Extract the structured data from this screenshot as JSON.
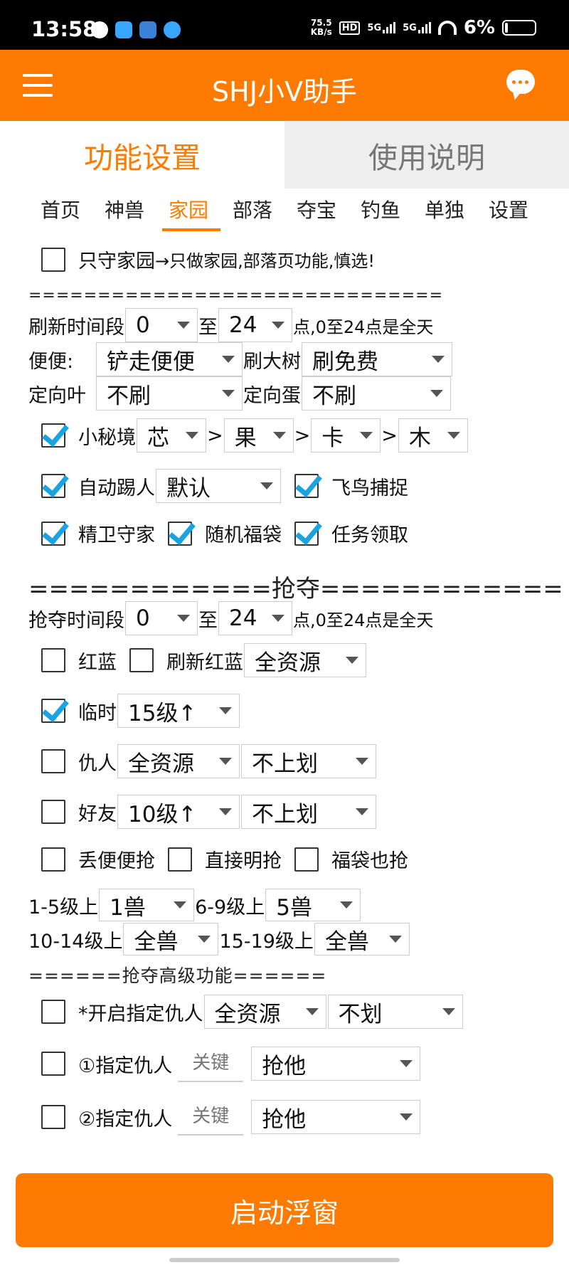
{
  "status_bar": {
    "time": "13:58",
    "net_speed_value": "75.5",
    "net_speed_unit": "KB/s",
    "signal1": "5G",
    "signal2": "5G",
    "hd_badge": "HD",
    "battery": "6%"
  },
  "app_bar": {
    "title": "SHJ小V助手"
  },
  "main_tabs": [
    {
      "label": "功能设置",
      "active": true
    },
    {
      "label": "使用说明",
      "active": false
    }
  ],
  "sub_tabs": [
    "首页",
    "神兽",
    "家园",
    "部落",
    "夺宝",
    "钓鱼",
    "单独",
    "设置"
  ],
  "active_sub_tab": "家园",
  "home_only": {
    "label": "只守家园",
    "note": "→只做家园,部落页功能,慎选!",
    "checked": false
  },
  "sep1": "==============================",
  "refresh": {
    "label": "刷新时间段",
    "from": "0",
    "to_label": "至",
    "to": "24",
    "suffix": "点,0至24点是全天"
  },
  "poop": {
    "label": "便便:",
    "value": "铲走便便",
    "tree_label": "刷大树",
    "tree_value": "刷免费"
  },
  "leaf": {
    "label": "定向叶",
    "value": "不刷",
    "egg_label": "定向蛋",
    "egg_value": "不刷"
  },
  "secret": {
    "label": "小秘境",
    "checked": true,
    "values": [
      "芯",
      "果",
      "卡",
      "木"
    ],
    "arrow": ">"
  },
  "kick": {
    "label": "自动踢人",
    "checked": true,
    "value": "默认",
    "bird_label": "飞鸟捕捉",
    "bird_checked": true
  },
  "guard_row": [
    {
      "label": "精卫守家",
      "checked": true
    },
    {
      "label": "随机福袋",
      "checked": true
    },
    {
      "label": "任务领取",
      "checked": true
    }
  ],
  "sep_rob": "============抢夺============",
  "rob_time": {
    "label": "抢夺时间段",
    "from": "0",
    "to_label": "至",
    "to": "24",
    "suffix": "点,0至24点是全天"
  },
  "redblue": {
    "label": "红蓝",
    "checked": false,
    "refresh_label": "刷新红蓝",
    "refresh_checked": false,
    "value": "全资源"
  },
  "temp": {
    "label": "临时",
    "checked": true,
    "value": "15级↑"
  },
  "enemy": {
    "label": "仇人",
    "checked": false,
    "value": "全资源",
    "value2": "不上划"
  },
  "friend": {
    "label": "好友",
    "checked": false,
    "value": "10级↑",
    "value2": "不上划"
  },
  "rob_opts": [
    {
      "label": "丢便便抢",
      "checked": false
    },
    {
      "label": "直接明抢",
      "checked": false
    },
    {
      "label": "福袋也抢",
      "checked": false
    }
  ],
  "level1": {
    "label_a": "1-5级上",
    "value_a": "1兽",
    "label_b": "6-9级上",
    "value_b": "5兽"
  },
  "level2": {
    "label_a": "10-14级上",
    "value_a": "全兽",
    "label_b": "15-19级上",
    "value_b": "全兽"
  },
  "sep_adv": "======抢夺高级功能======",
  "assign_enemy": {
    "label": "*开启指定仇人",
    "checked": false,
    "value": "全资源",
    "value2": "不划"
  },
  "target1": {
    "label": "①指定仇人",
    "checked": false,
    "placeholder": "关键",
    "value": "抢他"
  },
  "target2": {
    "label": "②指定仇人",
    "checked": false,
    "placeholder": "关键",
    "value": "抢他"
  },
  "start_button": "启动浮窗"
}
